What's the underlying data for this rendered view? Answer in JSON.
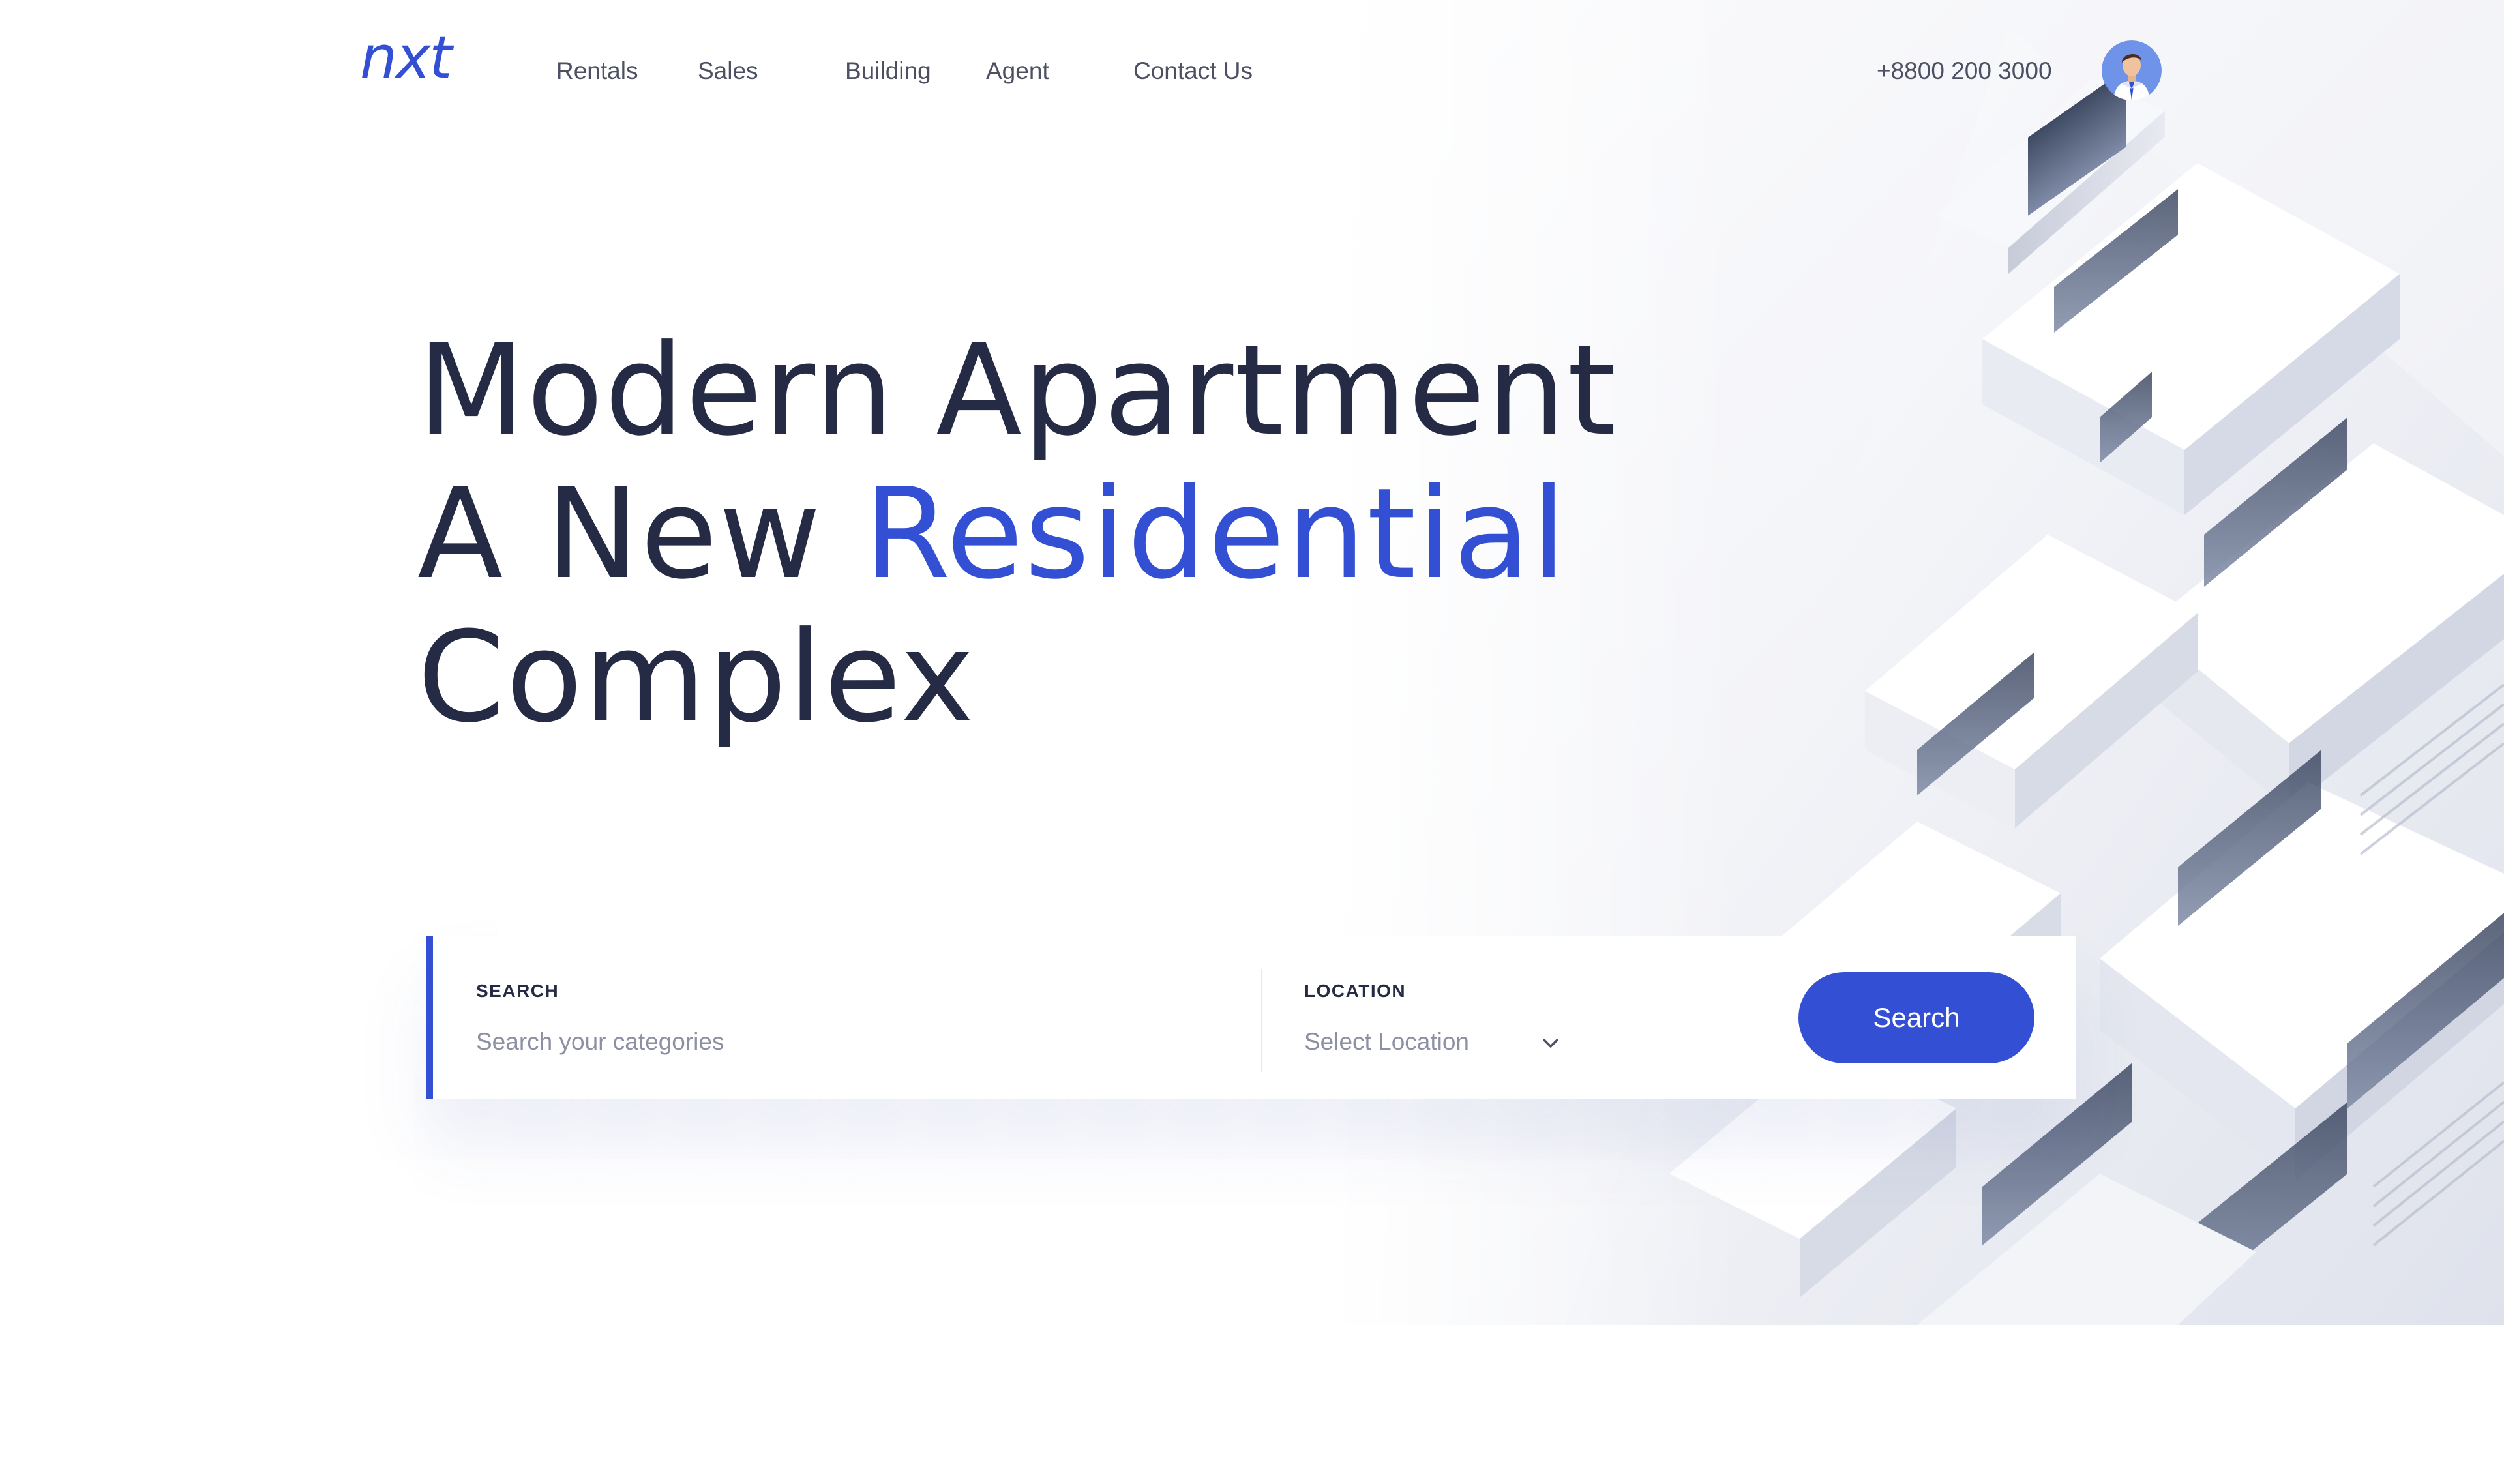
{
  "brand": {
    "logo_text": "nxt",
    "accent_color": "#3350d4",
    "text_color": "#262b45"
  },
  "nav": {
    "items": [
      {
        "label": "Rentals"
      },
      {
        "label": "Sales"
      },
      {
        "label": "Building"
      },
      {
        "label": "Agent"
      },
      {
        "label": "Contact Us"
      }
    ]
  },
  "header": {
    "phone": "+8800 200 3000",
    "avatar_icon": "user-avatar"
  },
  "hero": {
    "line1": "Modern Apartment",
    "line2_prefix": "A New",
    "line2_highlight": "Residential",
    "line3": "Complex",
    "image_subject": "modern white apartment building"
  },
  "search": {
    "label": "SEARCH",
    "placeholder": "Search your categories",
    "value": ""
  },
  "location": {
    "label": "LOCATION",
    "selected": "Select Location",
    "icon": "chevron-down-icon"
  },
  "search_button": {
    "label": "Search"
  }
}
